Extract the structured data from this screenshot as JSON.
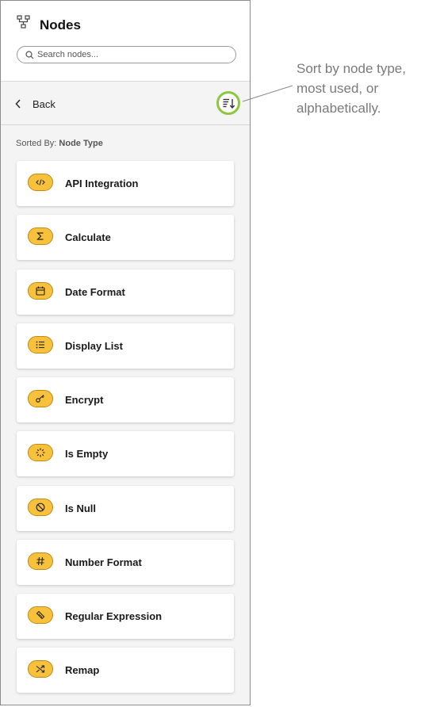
{
  "header": {
    "title": "Nodes",
    "search_placeholder": "Search nodes..."
  },
  "nav": {
    "back_label": "Back"
  },
  "sort": {
    "prefix": "Sorted By:",
    "value": "Node Type"
  },
  "nodes": [
    {
      "label": "API Integration",
      "icon": "code-icon"
    },
    {
      "label": "Calculate",
      "icon": "sigma-icon"
    },
    {
      "label": "Date Format",
      "icon": "calendar-icon"
    },
    {
      "label": "Display List",
      "icon": "list-icon"
    },
    {
      "label": "Encrypt",
      "icon": "key-icon"
    },
    {
      "label": "Is Empty",
      "icon": "loader-icon"
    },
    {
      "label": "Is Null",
      "icon": "ban-icon"
    },
    {
      "label": "Number Format",
      "icon": "hash-icon"
    },
    {
      "label": "Regular Expression",
      "icon": "regex-icon"
    },
    {
      "label": "Remap",
      "icon": "shuffle-icon"
    }
  ],
  "callout": {
    "text": "Sort by node type, most used, or alphabetically."
  },
  "colors": {
    "pill": "#f8c13b",
    "highlight": "#8dc63f",
    "panel_bg": "#f4f4f4"
  }
}
